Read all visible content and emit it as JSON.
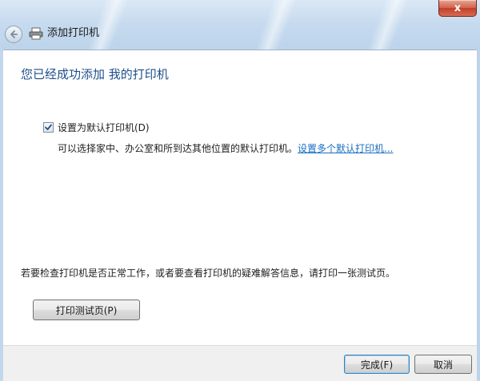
{
  "window": {
    "title": "添加打印机",
    "close_glyph": "x",
    "back_icon": "back-arrow-icon",
    "app_icon": "printer-icon"
  },
  "main": {
    "heading": "您已经成功添加 我的打印机",
    "default_checkbox": {
      "label": "设置为默认打印机(D)",
      "checked": true
    },
    "description": "可以选择家中、办公室和所到达其他位置的默认打印机。",
    "description_link": "设置多个默认打印机...",
    "info_text": "若要检查打印机是否正常工作，或者要查看打印机的疑难解答信息，请打印一张测试页。",
    "test_page_button": "打印测试页(P)"
  },
  "footer": {
    "finish_button": "完成(F)",
    "cancel_button": "取消"
  },
  "colors": {
    "heading": "#1e4f8a",
    "link": "#1a6ec2",
    "close": "#c0402c"
  }
}
